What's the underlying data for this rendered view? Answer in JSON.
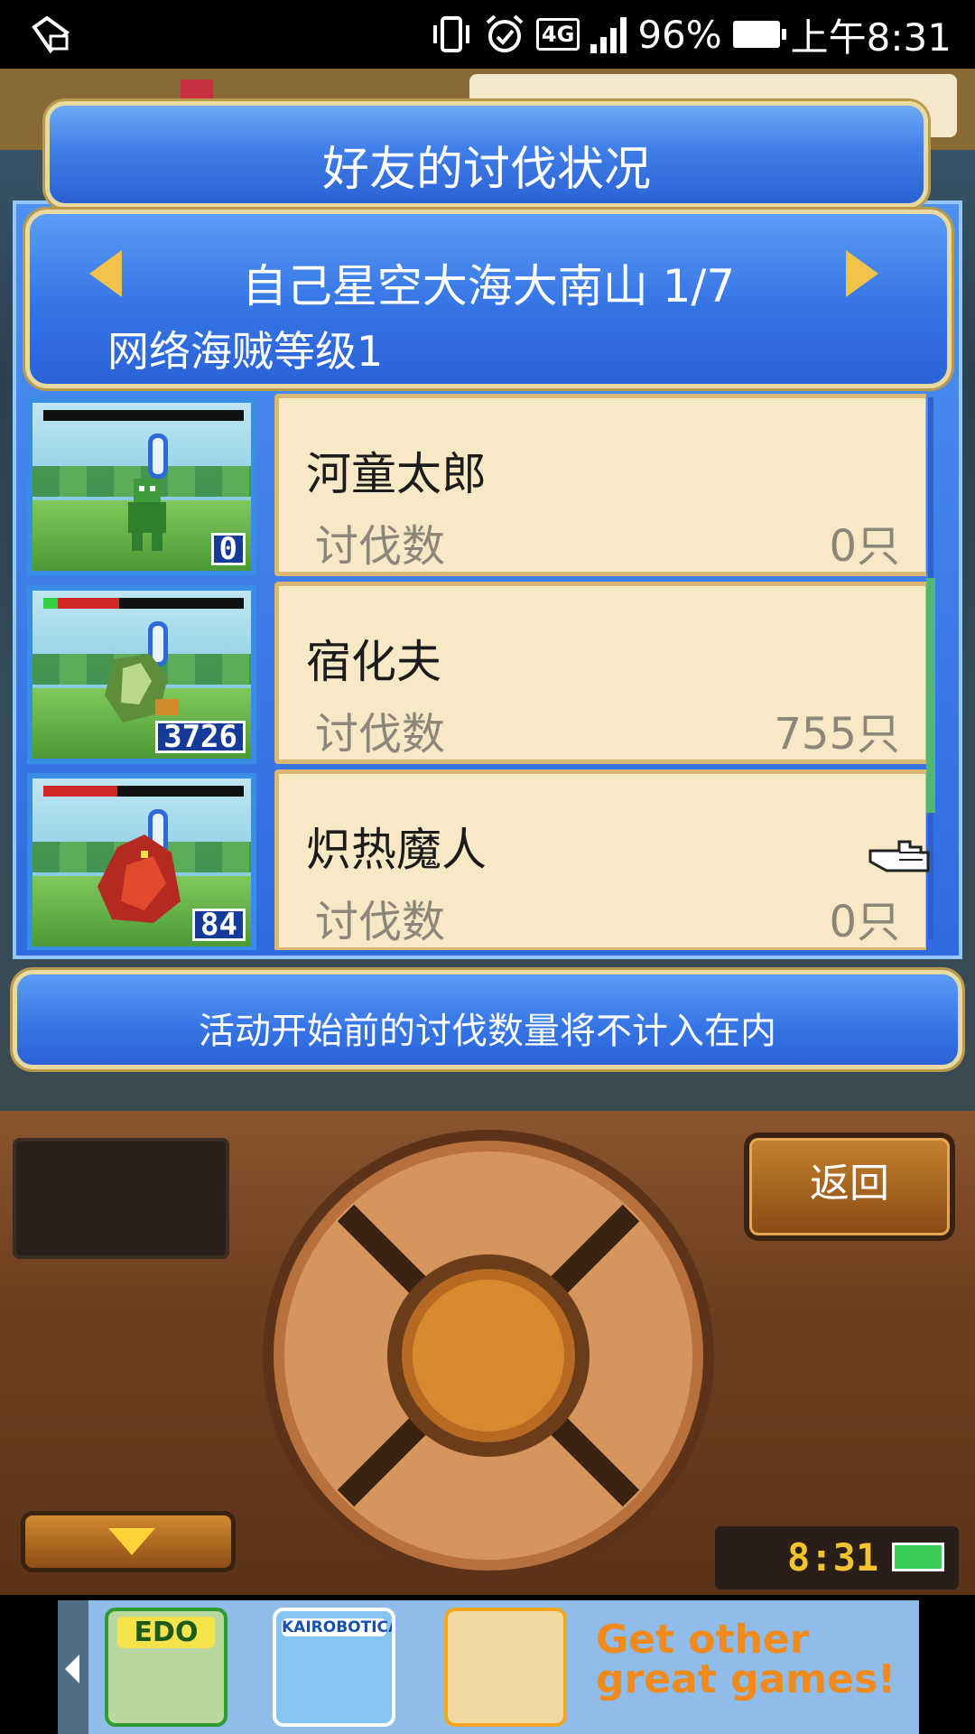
{
  "status_bar": {
    "battery_percent": "96%",
    "network": "4G",
    "time": "上午8:31",
    "icons": [
      "notification-icon",
      "vibrate-icon",
      "alarm-icon",
      "network-4g-icon",
      "signal-icon",
      "battery-icon"
    ]
  },
  "dialog": {
    "title": "好友的讨伐状况",
    "friend_name": "自己星空大海大南山 1/7",
    "pirate_level": "网络海贼等级1",
    "monsters": [
      {
        "name": "河童太郎",
        "kill_label": "讨伐数",
        "kill_value": "0只",
        "badge": "0",
        "hp_fraction": 0.0,
        "sprite_color": "#3e9a3a"
      },
      {
        "name": "宿化夫",
        "kill_label": "讨伐数",
        "kill_value": "755只",
        "badge": "3726",
        "hp_fraction": 0.38,
        "sprite_color": "#5e8d3c"
      },
      {
        "name": "炽热魔人",
        "kill_label": "讨伐数",
        "kill_value": "0只",
        "badge": "84",
        "hp_fraction": 0.37,
        "sprite_color": "#b42a22"
      }
    ],
    "notice": "活动开始前的讨伐数量将不计入在内"
  },
  "console": {
    "back_label": "返回",
    "clock": "8:31"
  },
  "ad": {
    "cta": "Get other great games!",
    "games": [
      "EDO",
      "KAIROBOTICA",
      ""
    ]
  },
  "colors": {
    "panel_blue": "#3574e4",
    "card_bg": "#f8e9c6",
    "gold": "#f2c34a",
    "console_brown": "#6d3f1e"
  }
}
